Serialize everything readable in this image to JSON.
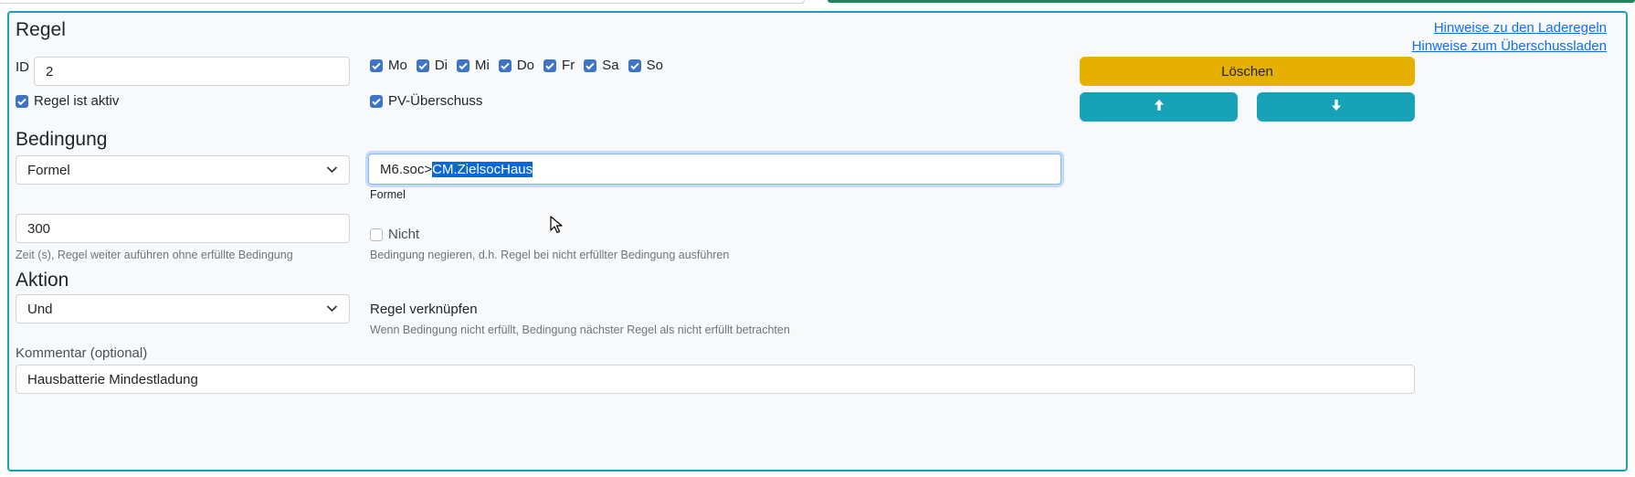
{
  "regel": {
    "title": "Regel",
    "links": {
      "laderegeln": "Hinweise zu den Laderegeln",
      "ueberschuss": "Hinweise zum Überschussladen"
    },
    "id_label": "ID",
    "id_value": "2",
    "active_label": "Regel ist aktiv",
    "active_checked": true,
    "days": [
      {
        "label": "Mo",
        "checked": true
      },
      {
        "label": "Di",
        "checked": true
      },
      {
        "label": "Mi",
        "checked": true
      },
      {
        "label": "Do",
        "checked": true
      },
      {
        "label": "Fr",
        "checked": true
      },
      {
        "label": "Sa",
        "checked": true
      },
      {
        "label": "So",
        "checked": true
      }
    ],
    "pv_label": "PV-Überschuss",
    "pv_checked": true,
    "delete_label": "Löschen"
  },
  "bedingung": {
    "title": "Bedingung",
    "type_value": "Formel",
    "formula_prefix": "M6.soc>",
    "formula_selected": "CM.ZielsocHaus",
    "formula_label": "Formel",
    "time_value": "300",
    "time_help": "Zeit (s), Regel weiter auführen ohne erfüllte Bedingung",
    "nicht_label": "Nicht",
    "nicht_checked": false,
    "nicht_help": "Bedingung negieren, d.h. Regel bei nicht erfüllter Bedingung ausführen"
  },
  "aktion": {
    "title": "Aktion",
    "type_value": "Und",
    "link_label": "Regel verknüpfen",
    "link_help": "Wenn Bedingung nicht erfüllt, Bedingung nächster Regel als nicht erfüllt betrachten"
  },
  "kommentar": {
    "label": "Kommentar (optional)",
    "value": "Hausbatterie Mindestladung"
  },
  "colors": {
    "panel_border": "#17a2b8",
    "delete_button": "#e6b000",
    "move_buttons": "#17a2b8",
    "checkbox": "#3e74c7",
    "link": "#0d6efd",
    "selection": "#0b66d6"
  },
  "icons": {
    "up": "arrow-up-icon",
    "down": "arrow-down-icon",
    "select": "chevron-down-icon"
  }
}
